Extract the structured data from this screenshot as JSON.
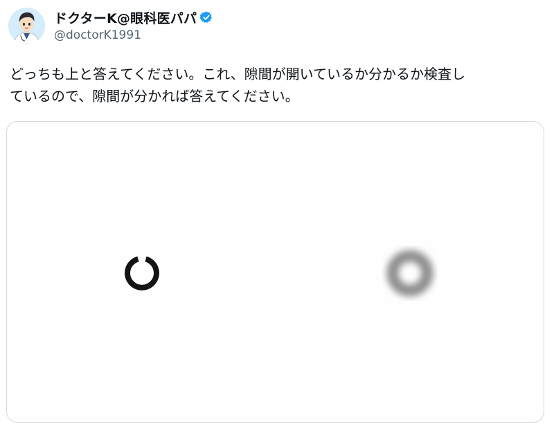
{
  "post": {
    "author": {
      "display_name": "ドクターK@眼科医パパ",
      "handle": "@doctorK1991",
      "verified": true,
      "avatar_icon": "doctor-avatar-icon",
      "verified_icon": "verified-badge-icon"
    },
    "text": "どっちも上と答えてください。これ、隙間が開いているか分かるか検査し\nているので、隙間が分かれば答えてください。",
    "media": {
      "left_ring": "sharp-ring-with-gap-top",
      "right_ring": "blurred-ring"
    }
  },
  "colors": {
    "text": "#0f1419",
    "secondary": "#536471",
    "verified": "#1d9bf0",
    "border": "#cfd9de",
    "ring": "#141414",
    "ring_blur": "#9a9a9a"
  }
}
